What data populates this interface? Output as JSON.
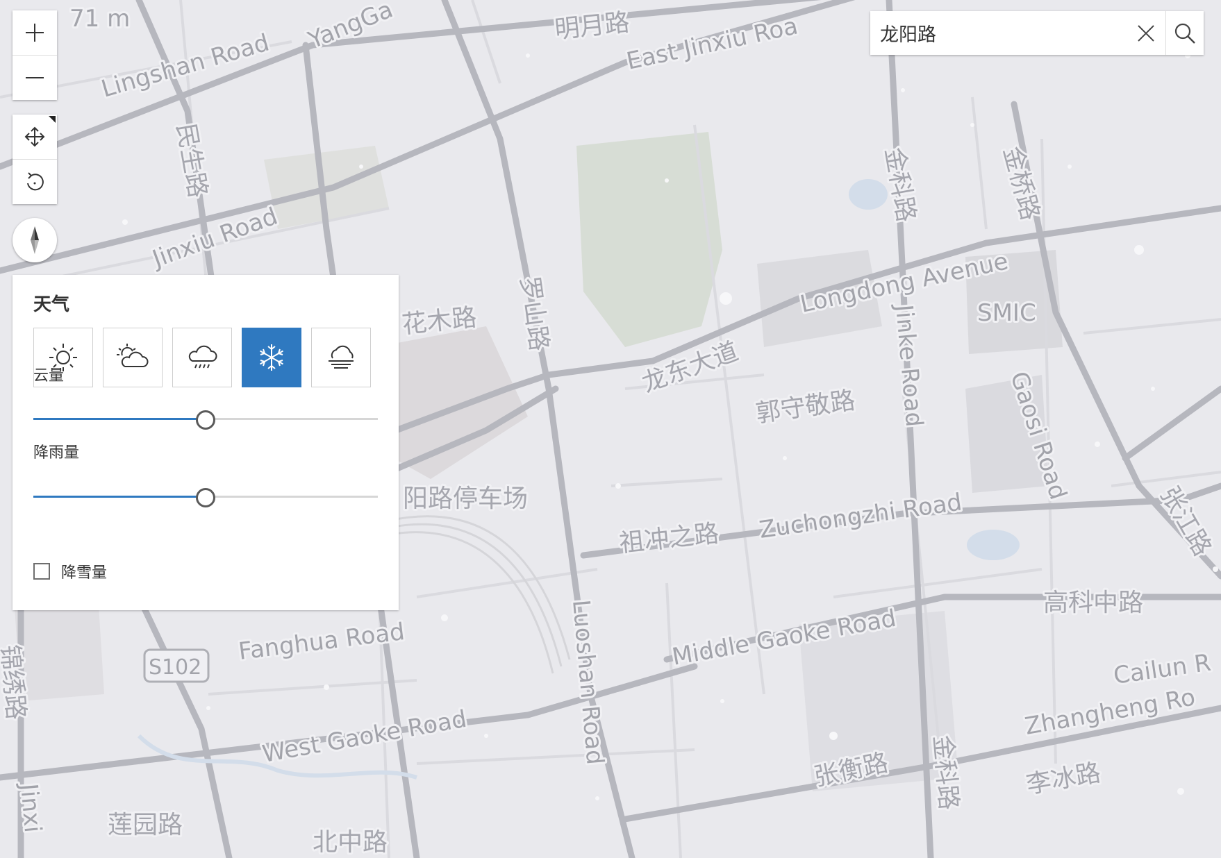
{
  "map": {
    "scale_label": "71 m",
    "labels": {
      "lingshan_road": "Lingshan Road",
      "yanggao": "YangGa",
      "mingyue_lu": "明月路",
      "east_jinxiu": "East Jinxiu Roa",
      "minsheng_lu": "民生路",
      "jinxiu_road": "Jinxiu Road",
      "jinke_lu_top": "金科路",
      "jinqiao_lu": "金桥路",
      "longdong_avenue": "Longdong Avenue",
      "smic": "SMIC",
      "huamu_lu": "花木路",
      "luoshan_lu": "罗山路",
      "jinke_road": "Jinke Road",
      "longdong_dadao": "龙东大道",
      "guoshoujing_lu": "郭守敬路",
      "gaosi_road": "Gaosi Road",
      "parking": "阳路停车场",
      "zuchongzhi_road": "Zuchongzhi Road",
      "zhangjiang_lu": "张江路",
      "zuchongzhi_lu": "祖冲之路",
      "middle_gaoke": "Middle Gaoke Road",
      "gaoke_zhong_lu": "高科中路",
      "fanghua_road": "Fanghua Road",
      "s102": "S102",
      "luoshan_road": "Luoshan Road",
      "cailun": "Cailun R",
      "jinxiu_lu": "锦绣路",
      "zhangheng_road": "Zhangheng Ro",
      "west_gaoke": "West Gaoke Road",
      "zhangheng_lu": "张衡路",
      "jinke_lu_bottom": "金科路",
      "libing_lu": "李冰路",
      "jinxi": "Jinxi",
      "lianyuan_lu": "莲园路",
      "beizhong_lu": "北中路"
    }
  },
  "search": {
    "value": "龙阳路"
  },
  "weather_panel": {
    "title": "天气",
    "options": [
      {
        "name": "sunny-icon"
      },
      {
        "name": "partly-cloudy-icon"
      },
      {
        "name": "rain-icon"
      },
      {
        "name": "snow-icon",
        "selected": true
      },
      {
        "name": "fog-icon"
      }
    ],
    "cloud_label": "云量",
    "cloud_value": 0.5,
    "rain_label": "降雨量",
    "rain_value": 0.5,
    "snow_label": "降雪量",
    "snow_checked": false
  },
  "colors": {
    "accent": "#2f79c0",
    "map_bg": "#e9e9ec",
    "road": "#9a9ba3"
  }
}
